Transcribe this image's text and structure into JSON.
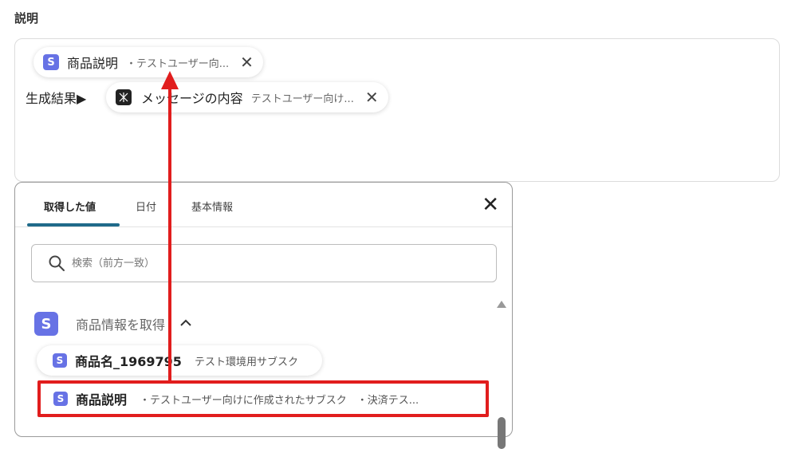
{
  "field": {
    "title": "説明"
  },
  "description": {
    "chip_product": {
      "name": "商品説明",
      "sub": "・テストユーザー向..."
    },
    "result_label": "生成結果▶",
    "chip_message": {
      "name": "メッセージの内容",
      "sub": "テストユーザー向け..."
    }
  },
  "panel": {
    "tabs": [
      {
        "label": "取得した値"
      },
      {
        "label": "日付"
      },
      {
        "label": "基本情報"
      }
    ],
    "search": {
      "placeholder": "検索（前方一致）"
    },
    "group": {
      "title": "商品情報を取得"
    },
    "items": [
      {
        "name": "商品名_1969795",
        "sub": "テスト環境用サブスク"
      },
      {
        "name": "商品説明",
        "sub": "・テストユーザー向けに作成されたサブスク　・決済テス..."
      }
    ]
  },
  "icons": {
    "service_letter": "S"
  },
  "colors": {
    "stripe_purple": "#6772e5",
    "tab_underline": "#1f6a8a",
    "highlight_red": "#e11d1d"
  }
}
